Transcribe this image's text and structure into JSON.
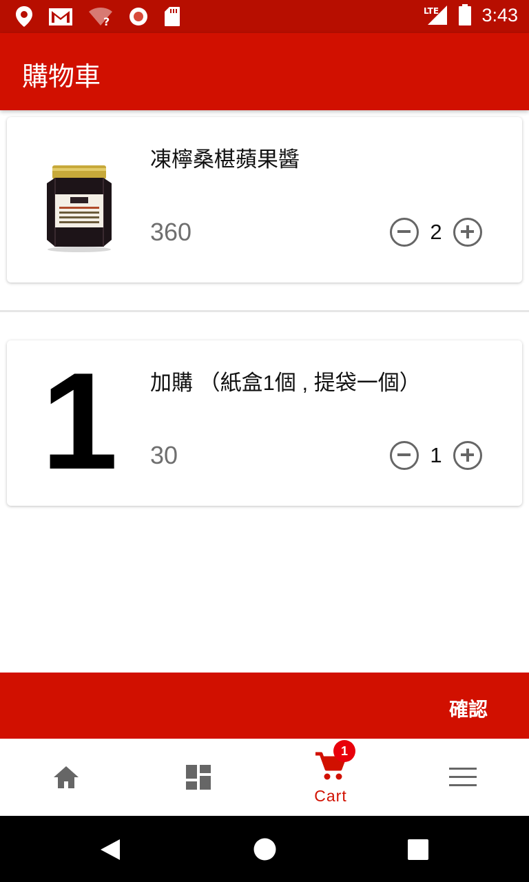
{
  "status_bar": {
    "time": "3:43",
    "network": "LTE",
    "icons_left": [
      "location-icon",
      "gmail-icon",
      "wifi-question-icon",
      "record-icon",
      "sdcard-icon"
    ],
    "icons_right": [
      "lte-signal-icon",
      "battery-icon"
    ]
  },
  "app_bar": {
    "title": "購物車"
  },
  "colors": {
    "primary": "#d11000",
    "status_bar": "#b70e00",
    "badge": "#e8000b",
    "price_text": "#6f6f6f"
  },
  "cart": {
    "items": [
      {
        "name": "凍檸桑椹蘋果醬",
        "price": "360",
        "quantity": "2",
        "thumbnail": "jam-jar-image"
      },
      {
        "name": "加購 （紙盒1個 , 提袋一個）",
        "price": "30",
        "quantity": "1",
        "thumbnail_text": "1"
      }
    ]
  },
  "confirm": {
    "label": "確認"
  },
  "bottom_nav": {
    "items": [
      {
        "icon": "home-icon",
        "label": ""
      },
      {
        "icon": "dashboard-icon",
        "label": ""
      },
      {
        "icon": "cart-icon",
        "label": "Cart",
        "badge": "1",
        "active": true
      },
      {
        "icon": "menu-icon",
        "label": ""
      }
    ]
  },
  "system_nav": [
    "back-icon",
    "home-circle-icon",
    "recents-icon"
  ]
}
